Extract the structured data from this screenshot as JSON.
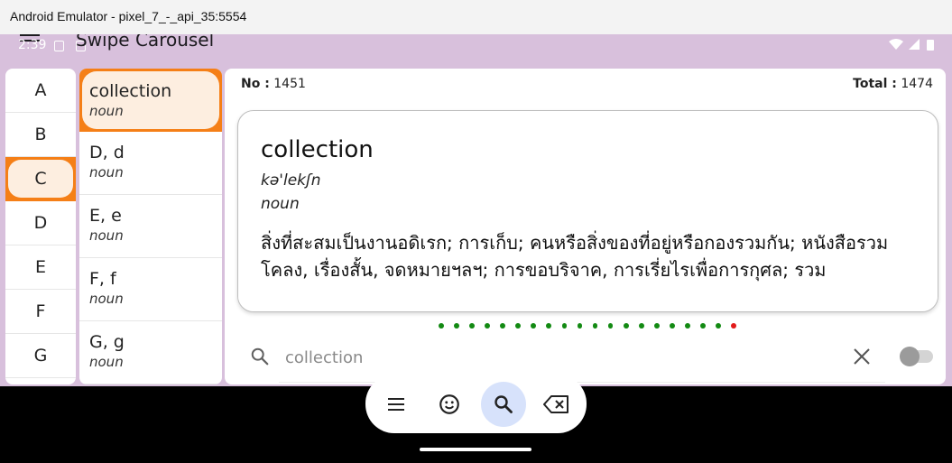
{
  "window": {
    "title": "Android Emulator - pixel_7_-_api_35:5554"
  },
  "status_bar": {
    "time": "2:39"
  },
  "app_bar": {
    "title": "Swipe Carousel"
  },
  "letters": [
    "A",
    "B",
    "C",
    "D",
    "E",
    "F",
    "G"
  ],
  "selected_letter": "C",
  "words": [
    {
      "word": "collection",
      "pos": "noun",
      "selected": true
    },
    {
      "word": "D, d",
      "pos": "noun"
    },
    {
      "word": "E, e",
      "pos": "noun"
    },
    {
      "word": "F, f",
      "pos": "noun"
    },
    {
      "word": "G, g",
      "pos": "noun"
    }
  ],
  "counter": {
    "no_label": "No :",
    "no_value": "1451",
    "total_label": "Total :",
    "total_value": "1474"
  },
  "card": {
    "word": "collection",
    "pronunciation": "kə'lekʃn",
    "pos": "noun",
    "definition": "สิ่งที่สะสมเป็นงานอดิเรก; การเก็บ; คนหรือสิ่งของที่อยู่หรือกองรวมกัน; หนังสือรวมโคลง, เรื่องสั้น, จดหมายฯลฯ; การขอบริจาค, การเรี่ยไรเพื่อการกุศล; รวม"
  },
  "pager": {
    "count": 20,
    "current_index": 19,
    "color": "#138a13",
    "current_color": "#e21a1a"
  },
  "search": {
    "value": "collection"
  },
  "toggle": {
    "on": false
  },
  "bottom_nav": {
    "active": "search",
    "items": [
      "menu-icon",
      "emoji-icon",
      "search-icon",
      "backspace-icon"
    ]
  },
  "colors": {
    "accent": "#f57f17",
    "selection_pill": "#fdeee0",
    "appbar": "#d8c0dc",
    "active_nav": "#d7e2fb"
  }
}
